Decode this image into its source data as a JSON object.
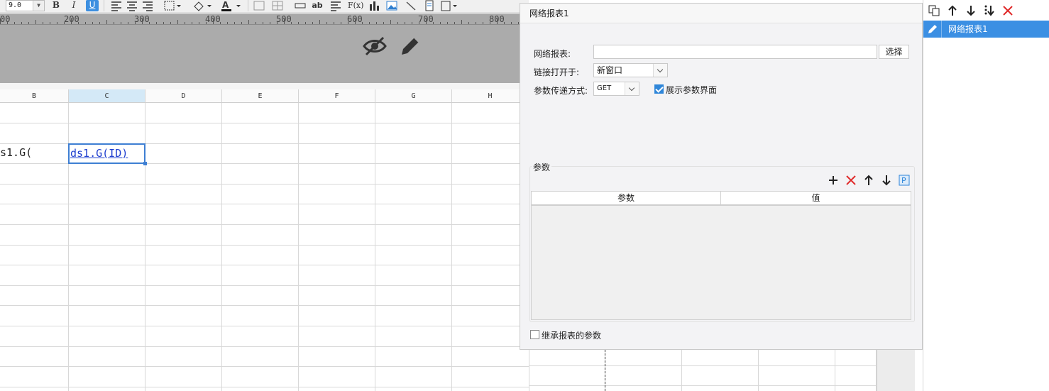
{
  "toolbar": {
    "font_size": "9.0",
    "bold_label": "B",
    "italic_label": "I",
    "underline_label": "U",
    "ab_label": "ab",
    "fx_label": "F(x)"
  },
  "ruler": {
    "labels": [
      "00",
      "200",
      "300",
      "400",
      "500",
      "600",
      "700",
      "800"
    ]
  },
  "sheet": {
    "columns": [
      "B",
      "C",
      "D",
      "E",
      "F",
      "G",
      "H"
    ],
    "selected_column": "C",
    "cell_b_text": "s1.G(",
    "cell_c_text": "ds1.G(ID)"
  },
  "dialog": {
    "title": "网络报表1",
    "report_label": "网络报表:",
    "report_value": "",
    "select_button": "选择",
    "open_in_label": "链接打开于:",
    "open_in_value": "新窗口",
    "param_method_label": "参数传递方式:",
    "param_method_value": "GET",
    "show_params_label": "展示参数界面",
    "show_params_checked": true,
    "params_group_label": "参数",
    "table_headers": [
      "参数",
      "值"
    ],
    "inherit_label": "继承报表的参数",
    "inherit_checked": false
  },
  "right_panel": {
    "items": [
      "网络报表1"
    ]
  },
  "colors": {
    "accent": "#3b8fe3",
    "delete": "#e02b2b",
    "selection_border": "#3e7fd3",
    "link_text": "#1f3fcf"
  }
}
